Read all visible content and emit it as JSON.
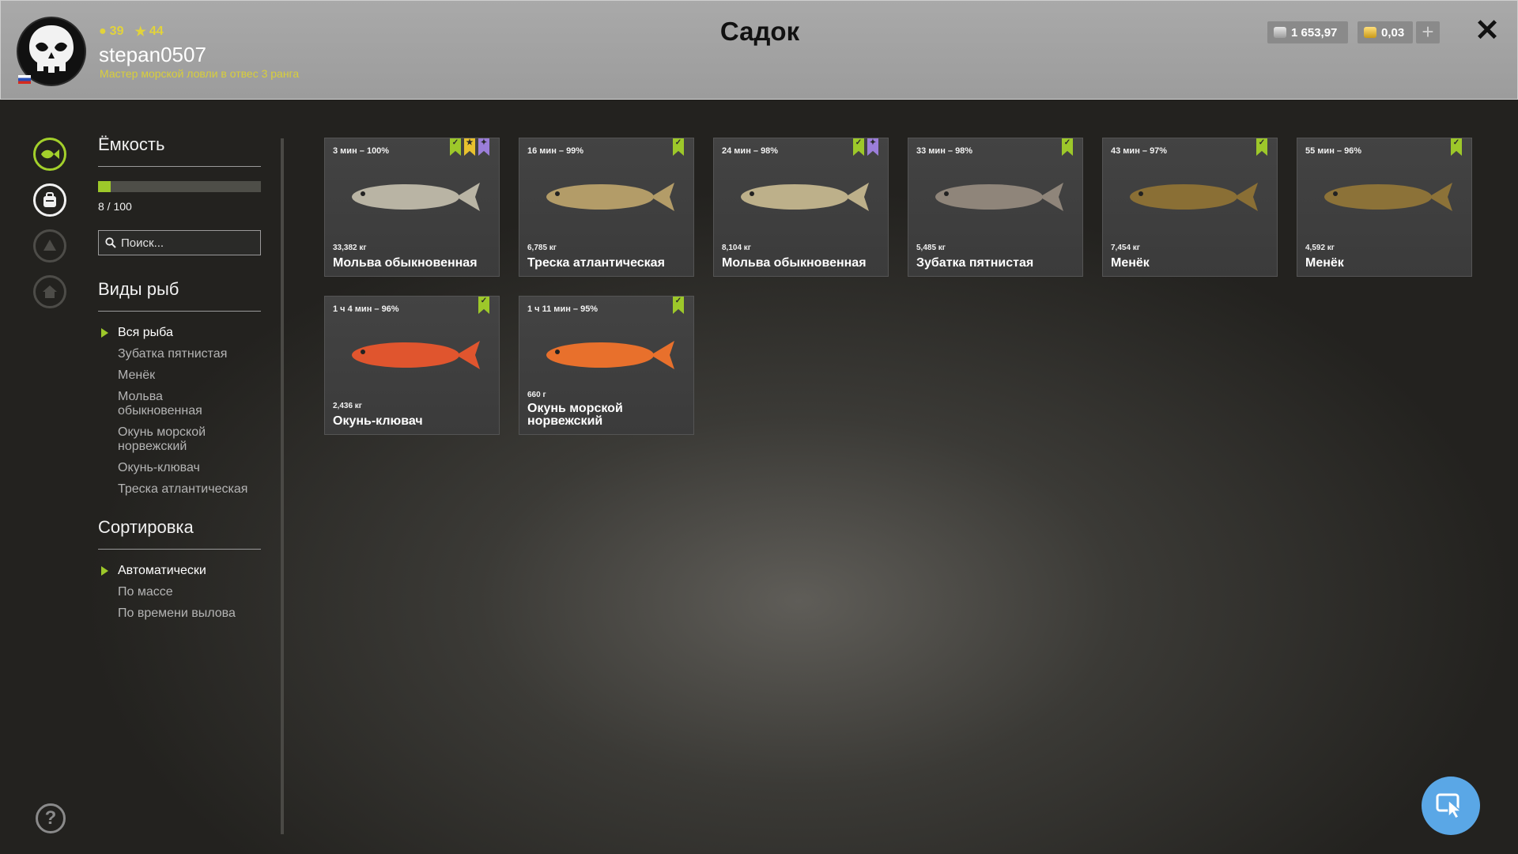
{
  "header": {
    "title": "Садок",
    "username": "stepan0507",
    "rank_text": "Мастер морской ловли в отвес 3 ранга",
    "level": "39",
    "stars": "44",
    "silver": "1 653,97",
    "gold": "0,03",
    "plus_label": "+",
    "close_label": "✕"
  },
  "capacity": {
    "title": "Ёмкость",
    "text": "8 / 100",
    "fraction": 0.08
  },
  "search": {
    "placeholder": "Поиск..."
  },
  "species": {
    "title": "Виды рыб",
    "items": [
      "Вся рыба",
      "Зубатка пятнистая",
      "Менёк",
      "Мольва обыкновенная",
      "Окунь морской норвежский",
      "Окунь-клювач",
      "Треска атлантическая"
    ]
  },
  "sort": {
    "title": "Сортировка",
    "items": [
      "Автоматически",
      "По массе",
      "По времени вылова"
    ]
  },
  "fish_cards": [
    {
      "time": "3 мин – 100%",
      "weight": "33,382 кг",
      "name": "Мольва обыкновенная",
      "color": "#b9b4a4",
      "badges": [
        "green",
        "yellow",
        "purple"
      ]
    },
    {
      "time": "16 мин – 99%",
      "weight": "6,785 кг",
      "name": "Треска атлантическая",
      "color": "#b39c68",
      "badges": [
        "green"
      ]
    },
    {
      "time": "24 мин – 98%",
      "weight": "8,104 кг",
      "name": "Мольва обыкновенная",
      "color": "#bdb08a",
      "badges": [
        "green",
        "purple"
      ]
    },
    {
      "time": "33 мин – 98%",
      "weight": "5,485 кг",
      "name": "Зубатка пятнистая",
      "color": "#8f857a",
      "badges": [
        "green"
      ]
    },
    {
      "time": "43 мин – 97%",
      "weight": "7,454 кг",
      "name": "Менёк",
      "color": "#8a6f35",
      "badges": [
        "green"
      ]
    },
    {
      "time": "55 мин – 96%",
      "weight": "4,592 кг",
      "name": "Менёк",
      "color": "#8c7238",
      "badges": [
        "green"
      ]
    },
    {
      "time": "1 ч 4 мин – 96%",
      "weight": "2,436 кг",
      "name": "Окунь-клювач",
      "color": "#e0552e",
      "badges": [
        "green"
      ]
    },
    {
      "time": "1 ч 11 мин – 95%",
      "weight": "660 г",
      "name": "Окунь морской норвежский",
      "color": "#e8702c",
      "badges": [
        "green"
      ]
    }
  ],
  "colors": {
    "accent": "#9dc82a",
    "header_bg": "#a3a3a3",
    "card_bg": "#404040",
    "cursor_button": "#5aa7e6"
  }
}
